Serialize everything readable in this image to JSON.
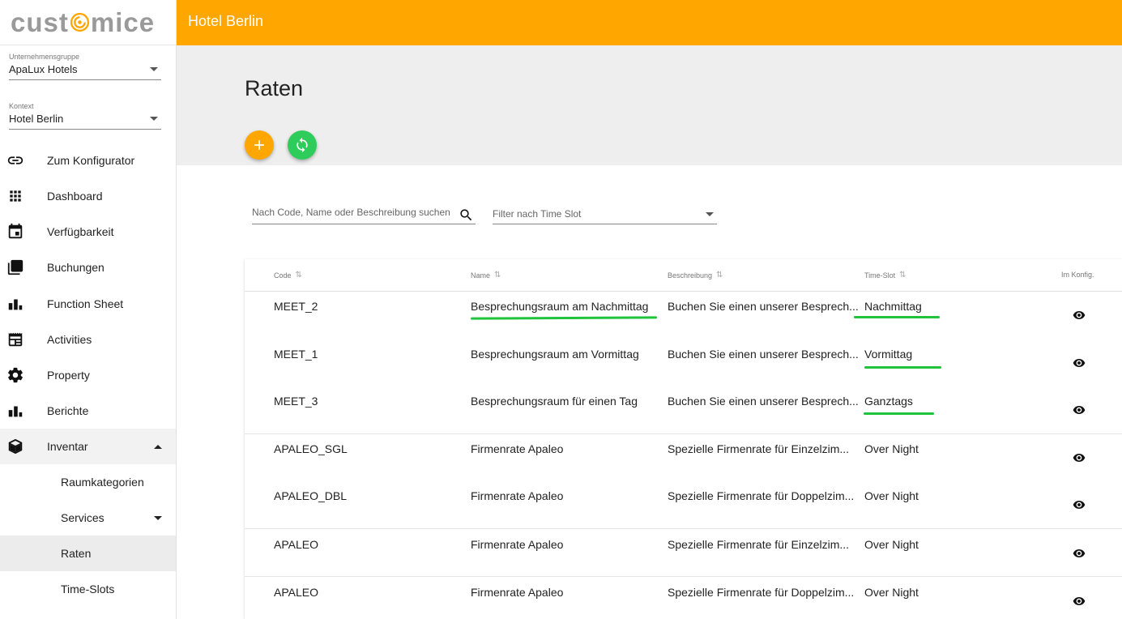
{
  "app": {
    "logo_text_left": "cust",
    "logo_text_right": "mice",
    "hotel_title": "Hotel Berlin"
  },
  "sidebar": {
    "group_label": "Unternehmensgruppe",
    "group_value": "ApaLux Hotels",
    "context_label": "Kontext",
    "context_value": "Hotel Berlin",
    "items": [
      {
        "label": "Zum Konfigurator",
        "icon": "link-icon"
      },
      {
        "label": "Dashboard",
        "icon": "grid-icon"
      },
      {
        "label": "Verfügbarkeit",
        "icon": "calendar-icon"
      },
      {
        "label": "Buchungen",
        "icon": "copy-icon"
      },
      {
        "label": "Function Sheet",
        "icon": "bar-chart-icon"
      },
      {
        "label": "Activities",
        "icon": "newspaper-icon"
      },
      {
        "label": "Property",
        "icon": "gear-icon"
      },
      {
        "label": "Berichte",
        "icon": "bar-chart-icon"
      },
      {
        "label": "Inventar",
        "icon": "cube-icon"
      },
      {
        "label": "Raumkategorien"
      },
      {
        "label": "Services"
      },
      {
        "label": "Raten"
      },
      {
        "label": "Time-Slots"
      }
    ]
  },
  "page": {
    "title": "Raten",
    "search_placeholder": "Nach Code, Name oder Beschreibung suchen",
    "filter_placeholder": "Filter nach Time Slot"
  },
  "table": {
    "headers": [
      "Code",
      "Name",
      "Beschreibung",
      "Time-Slot",
      "Im Konfig."
    ],
    "rows": [
      {
        "code": "MEET_2",
        "name": "Besprechungsraum am Nachmittag",
        "desc": "Buchen Sie einen unserer Besprech...",
        "slot": "Nachmittag"
      },
      {
        "code": "MEET_1",
        "name": "Besprechungsraum am Vormittag",
        "desc": "Buchen Sie einen unserer Besprech...",
        "slot": "Vormittag"
      },
      {
        "code": "MEET_3",
        "name": "Besprechungsraum für einen Tag",
        "desc": "Buchen Sie einen unserer Besprech...",
        "slot": "Ganztags"
      },
      {
        "code": "APALEO_SGL",
        "name": "Firmenrate Apaleo",
        "desc": "Spezielle Firmenrate für Einzelzim...",
        "slot": "Over Night"
      },
      {
        "code": "APALEO_DBL",
        "name": "Firmenrate Apaleo",
        "desc": "Spezielle Firmenrate für Doppelzim...",
        "slot": "Over Night"
      },
      {
        "code": "APALEO",
        "name": "Firmenrate Apaleo",
        "desc": "Spezielle Firmenrate für Einzelzim...",
        "slot": "Over Night"
      },
      {
        "code": "APALEO",
        "name": "Firmenrate Apaleo",
        "desc": "Spezielle Firmenrate für Doppelzim...",
        "slot": "Over Night"
      }
    ]
  },
  "colors": {
    "accent": "#ffa600",
    "refresh": "#2ecc5a",
    "highlight": "#1fc43c"
  }
}
